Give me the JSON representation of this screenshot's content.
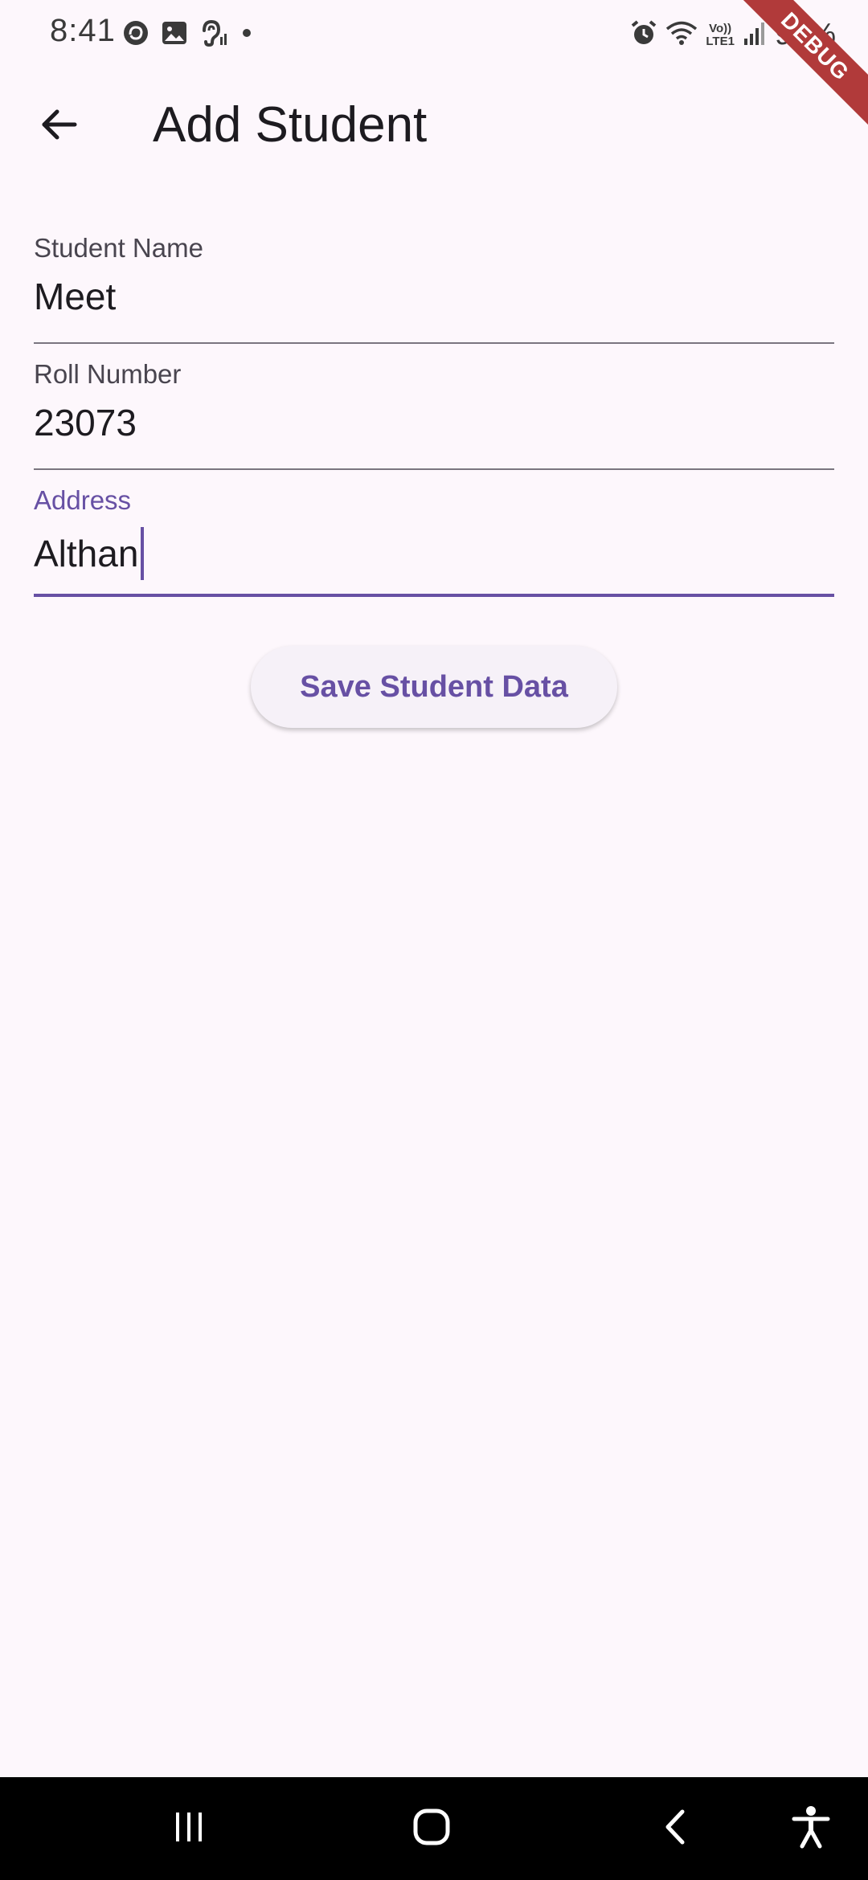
{
  "status_bar": {
    "time": "8:41",
    "battery": "90%",
    "network_top": "Vo))",
    "network_bottom": "LTE1",
    "left_icons": [
      "sync-icon",
      "gallery-icon",
      "hearing-icon",
      "dot-icon"
    ],
    "right_icons": [
      "alarm-icon",
      "wifi-icon",
      "signal-icon",
      "battery-icon"
    ]
  },
  "debug_banner": "DEBUG",
  "app_bar": {
    "title": "Add Student",
    "back_icon": "arrow-back-icon"
  },
  "form": {
    "name_label": "Student Name",
    "name_value": "Meet",
    "roll_label": "Roll Number",
    "roll_value": "23073",
    "address_label": "Address",
    "address_value": "Althan"
  },
  "save_button": "Save Student Data",
  "nav_bar": {
    "buttons": [
      "recents-icon",
      "home-icon",
      "back-icon",
      "accessibility-icon"
    ]
  },
  "colors": {
    "background": "#fdf7fc",
    "accent": "#6750a4",
    "debug": "#b13a3a",
    "nav": "#000000"
  }
}
